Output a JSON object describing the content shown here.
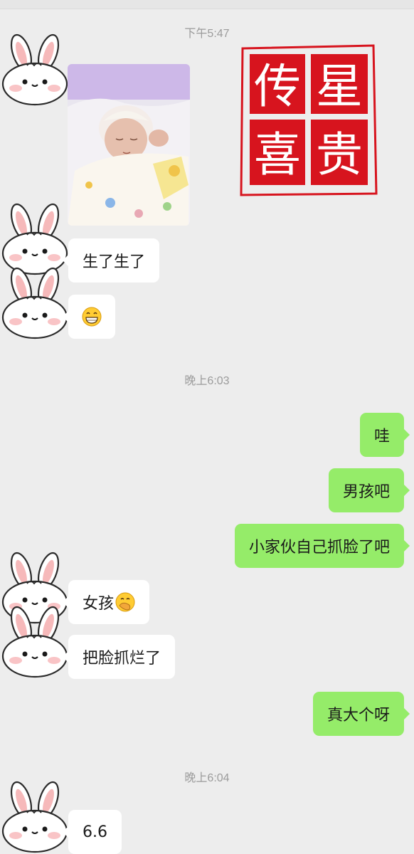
{
  "timestamps": [
    "下午5:47",
    "晚上6:03",
    "晚上6:04"
  ],
  "seal": {
    "chars": [
      "传",
      "星",
      "喜",
      "贵"
    ],
    "color": "#d7141e"
  },
  "photo": {
    "subject": "newborn-baby-photo"
  },
  "messages": [
    {
      "side": "left",
      "text": "生了生了"
    },
    {
      "side": "left",
      "text": "",
      "emoji": "grinning-face"
    },
    {
      "side": "right",
      "text": "哇"
    },
    {
      "side": "right",
      "text": "男孩吧"
    },
    {
      "side": "right",
      "text": "小家伙自己抓脸了吧"
    },
    {
      "side": "left",
      "text": "女孩",
      "emoji": "hand-over-mouth-face"
    },
    {
      "side": "left",
      "text": "把脸抓烂了"
    },
    {
      "side": "right",
      "text": "真大个呀"
    },
    {
      "side": "left",
      "text": "6.6"
    }
  ],
  "colors": {
    "background": "#ededed",
    "left_bubble": "#ffffff",
    "right_bubble": "#95ec69",
    "timestamp": "#9b9b9b"
  }
}
